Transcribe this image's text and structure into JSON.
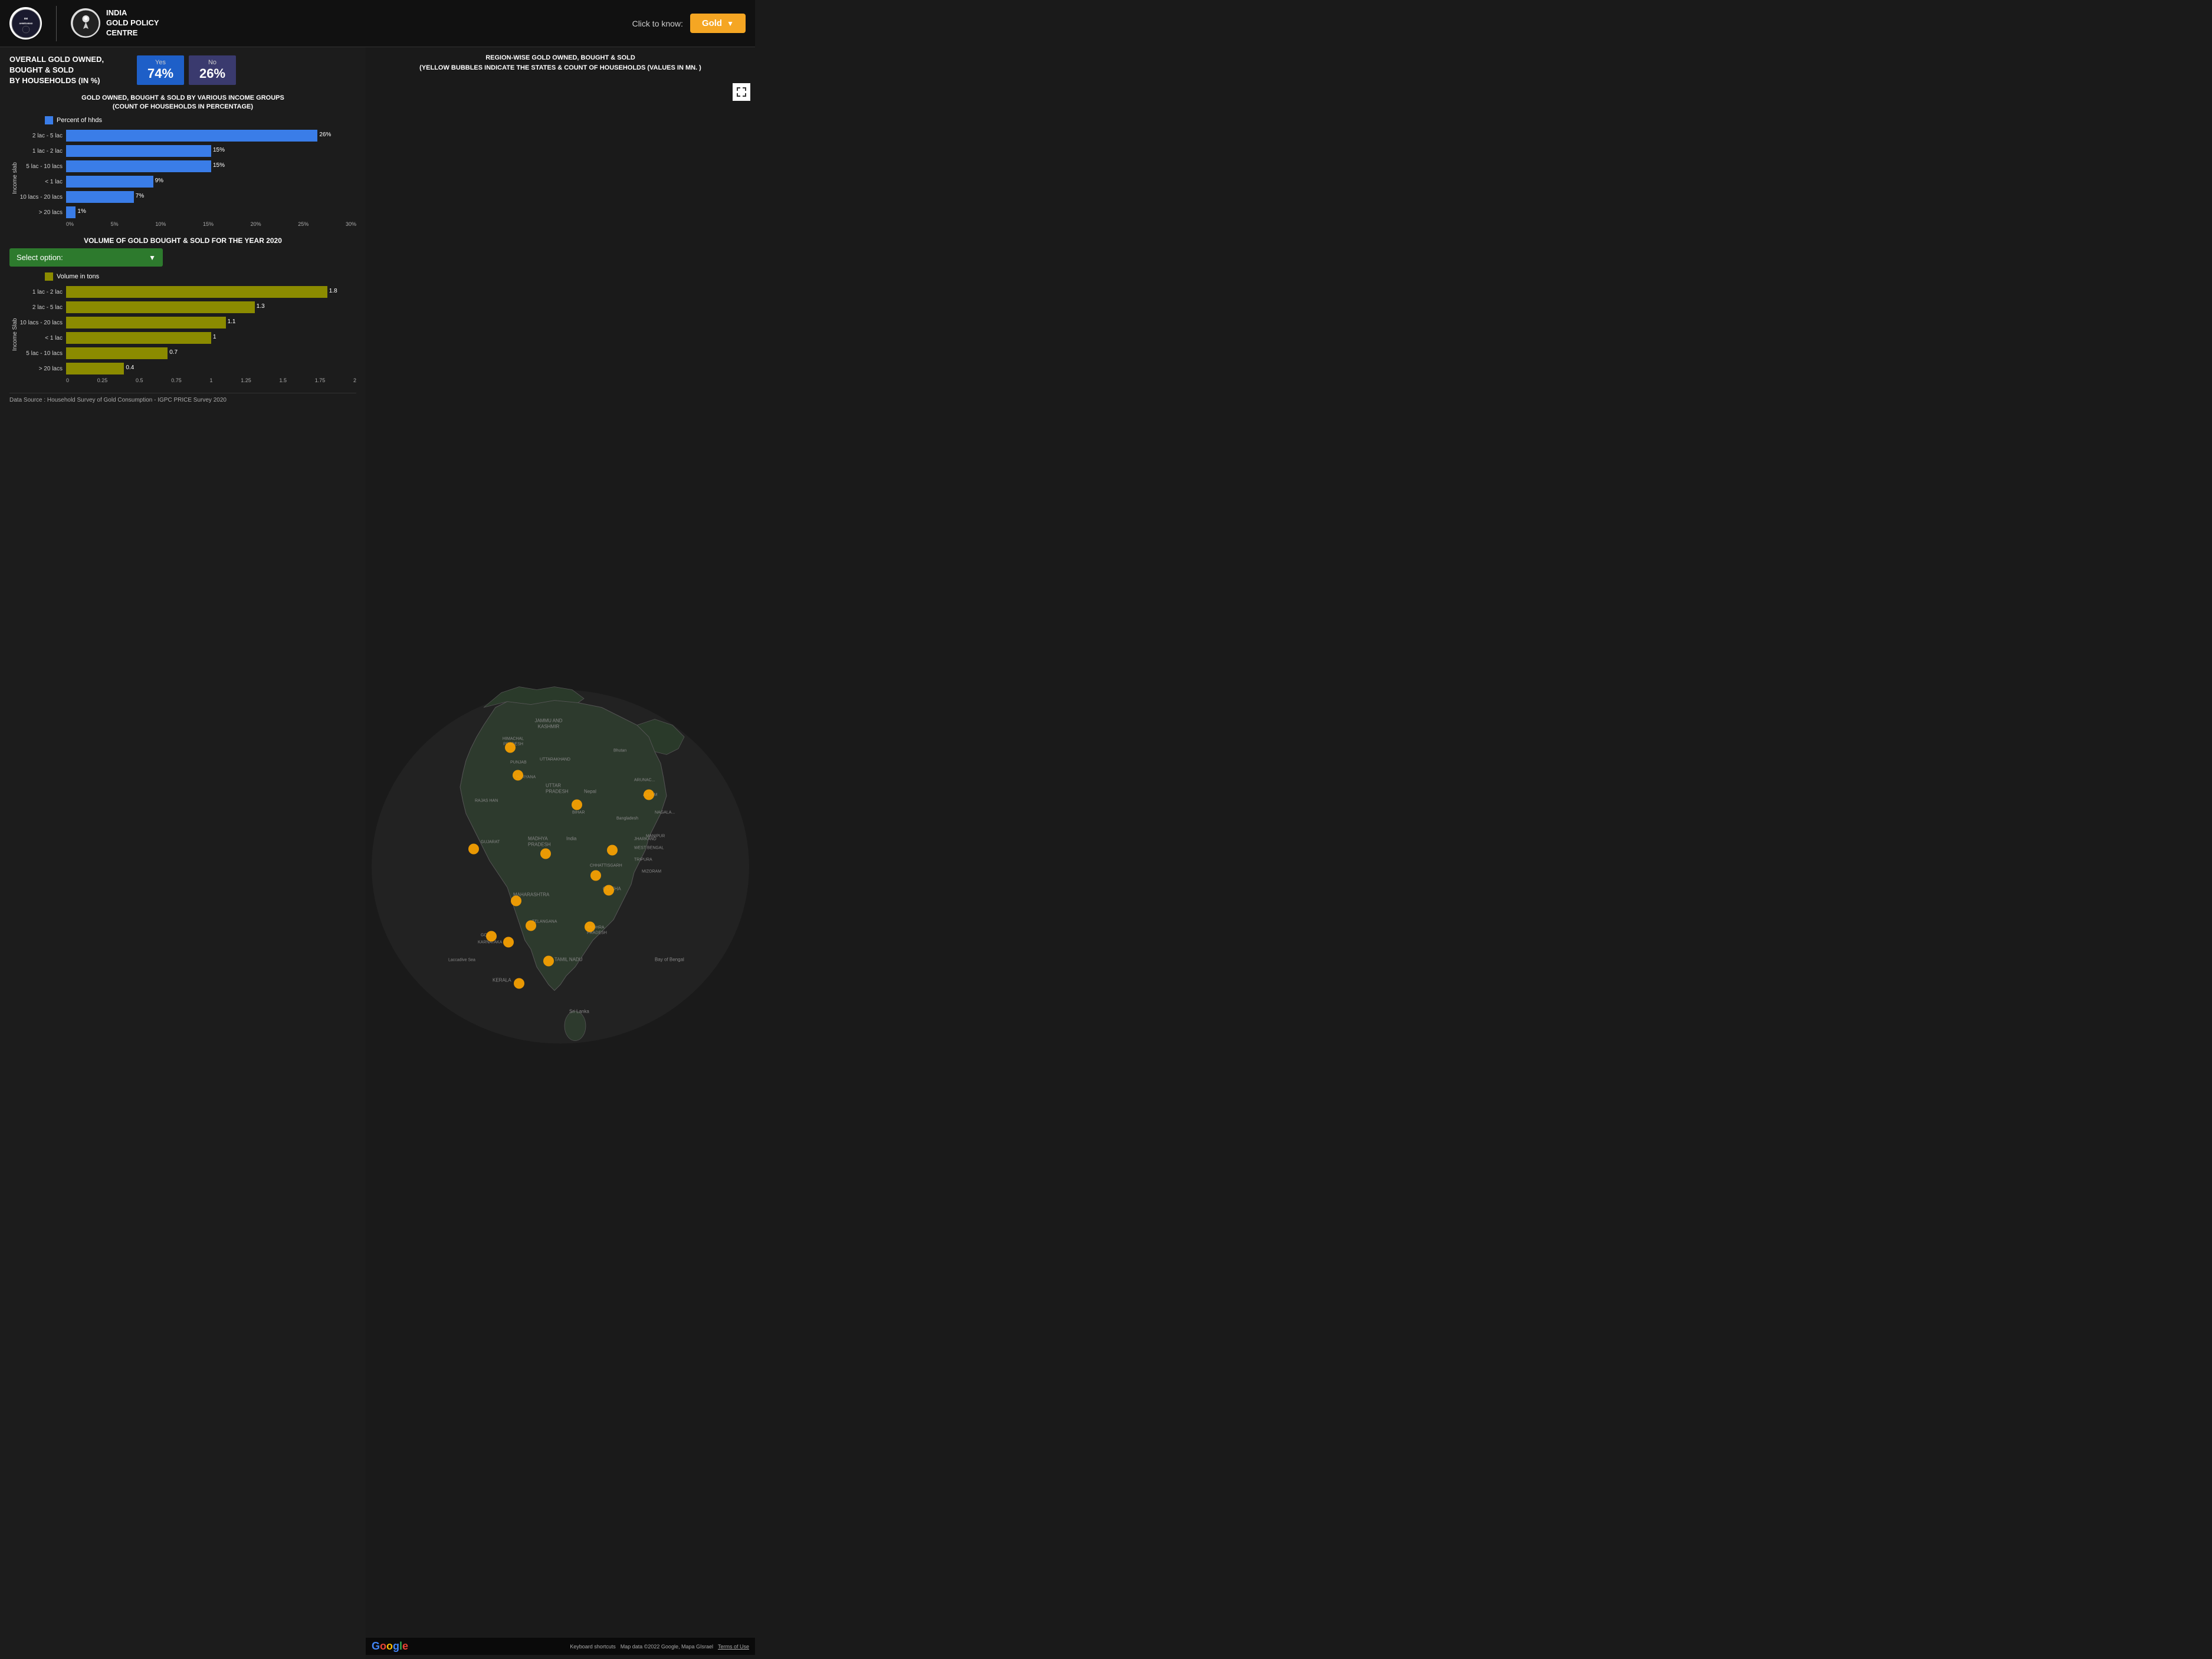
{
  "header": {
    "iim_name": "IIM AHMEDABAD",
    "igpc_title": "INDIA\nGOLD POLICY\nCENTRE",
    "click_to_know": "Click to know:",
    "dropdown_value": "Gold"
  },
  "overall": {
    "title": "OVERALL GOLD OWNED, BOUGHT & SOLD\nBY HOUSEHOLDS (IN %)",
    "yes_label": "Yes",
    "yes_value": "74%",
    "no_label": "No",
    "no_value": "26%"
  },
  "chart1": {
    "title": "GOLD OWNED, BOUGHT & SOLD BY VARIOUS INCOME GROUPS\n(COUNT OF HOUSEHOLDS IN PERCENTAGE)",
    "legend_label": "Percent of hhds",
    "y_axis_label": "Income slab",
    "bars": [
      {
        "label": "2 lac - 5 lac",
        "value": 26,
        "display": "26%"
      },
      {
        "label": "1 lac - 2 lac",
        "value": 15,
        "display": "15%"
      },
      {
        "label": "5 lac - 10 lacs",
        "value": 15,
        "display": "15%"
      },
      {
        "label": "< 1 lac",
        "value": 9,
        "display": "9%"
      },
      {
        "label": "10 lacs - 20 lacs",
        "value": 7,
        "display": "7%"
      },
      {
        "label": "> 20 lacs",
        "value": 1,
        "display": "1%"
      }
    ],
    "x_ticks": [
      "0%",
      "5%",
      "10%",
      "15%",
      "20%",
      "25%",
      "30%"
    ]
  },
  "volume": {
    "title": "VOLUME OF GOLD BOUGHT & SOLD FOR THE YEAR 2020",
    "select_label": "Select option:",
    "legend_label": "Volume in tons",
    "y_axis_label": "Income Slab",
    "bars": [
      {
        "label": "1 lac - 2 lac",
        "value": 1.8,
        "display": "1.8",
        "max": 2
      },
      {
        "label": "2 lac - 5 lac",
        "value": 1.3,
        "display": "1.3",
        "max": 2
      },
      {
        "label": "10 lacs - 20 lacs",
        "value": 1.1,
        "display": "1.1",
        "max": 2
      },
      {
        "label": "< 1 lac",
        "value": 1.0,
        "display": "1",
        "max": 2
      },
      {
        "label": "5 lac - 10 lacs",
        "value": 0.7,
        "display": "0.7",
        "max": 2
      },
      {
        "label": "> 20 lacs",
        "value": 0.4,
        "display": "0.4",
        "max": 2
      }
    ],
    "x_ticks": [
      "0",
      "0.25",
      "0.5",
      "0.75",
      "1",
      "1.25",
      "1.5",
      "1.75",
      "2"
    ]
  },
  "footer": {
    "text": "Data Source : Household Survey of Gold Consumption -  IGPC PRICE Survey 2020"
  },
  "map": {
    "title": "REGION-WISE GOLD OWNED, BOUGHT & SOLD\n(YELLOW BUBBLES INDICATE THE STATES & COUNT OF HOUSEHOLDS (VALUES IN MN. )",
    "attribution": "Map data ©2022 Google, Mapa GIsrael",
    "keyboard_shortcuts": "Keyboard shortcuts",
    "terms": "Terms of Use",
    "bubbles": [
      {
        "name": "Himachal Pradesh",
        "cx": 200,
        "cy": 135
      },
      {
        "name": "Haryana",
        "cx": 215,
        "cy": 185
      },
      {
        "name": "Bihar",
        "cx": 355,
        "cy": 235
      },
      {
        "name": "Assam",
        "cx": 465,
        "cy": 215
      },
      {
        "name": "Gujarat",
        "cx": 130,
        "cy": 325
      },
      {
        "name": "Madhya Pradesh",
        "cx": 250,
        "cy": 320
      },
      {
        "name": "Jharkhand",
        "cx": 380,
        "cy": 305
      },
      {
        "name": "West Bengal",
        "cx": 435,
        "cy": 310
      },
      {
        "name": "Chhattisgarh",
        "cx": 325,
        "cy": 350
      },
      {
        "name": "Odisha",
        "cx": 405,
        "cy": 365
      },
      {
        "name": "Maharashtra",
        "cx": 235,
        "cy": 400
      },
      {
        "name": "Telangana",
        "cx": 280,
        "cy": 445
      },
      {
        "name": "Andhra Pradesh (1)",
        "cx": 360,
        "cy": 450
      },
      {
        "name": "Andhra Pradesh (2)",
        "cx": 390,
        "cy": 450
      },
      {
        "name": "Goa/Karnataka (1)",
        "cx": 210,
        "cy": 465
      },
      {
        "name": "Goa/Karnataka (2)",
        "cx": 240,
        "cy": 475
      },
      {
        "name": "Karnataka (2)",
        "cx": 245,
        "cy": 485
      },
      {
        "name": "Tamil Nadu",
        "cx": 295,
        "cy": 510
      },
      {
        "name": "Kerala",
        "cx": 265,
        "cy": 545
      }
    ]
  }
}
